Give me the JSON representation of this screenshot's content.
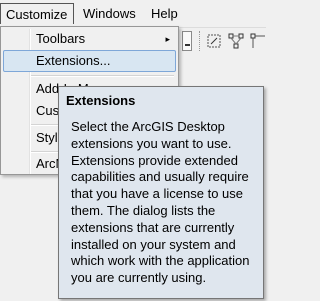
{
  "menubar": {
    "items": [
      {
        "label": "Customize"
      },
      {
        "label": "Windows"
      },
      {
        "label": "Help"
      }
    ]
  },
  "customize_menu": {
    "items": [
      {
        "label": "Toolbars",
        "submenu": true
      },
      {
        "label": "Extensions...",
        "highlighted": true
      },
      {
        "label": "Add-In M"
      },
      {
        "label": "Cust"
      },
      {
        "label": "Style"
      },
      {
        "label": "ArcM"
      }
    ],
    "submenu_arrow": "▸"
  },
  "tooltip": {
    "title": "Extensions",
    "body": "Select the ArcGIS Desktop extensions you want to use. Extensions provide extended capabilities and usually require that you have a license to use them. The dialog lists the extensions that are currently installed on your system and which work with the application you are currently using."
  },
  "toolbar_icons": [
    "select-box-icon",
    "node-edit-icon",
    "vertex-edit-icon"
  ],
  "colors": {
    "menu_bg": "#f0f0f0",
    "hover_bg": "#d8e6f2",
    "hover_border": "#7ea7d8",
    "tooltip_bg": "#dfe6ee"
  }
}
